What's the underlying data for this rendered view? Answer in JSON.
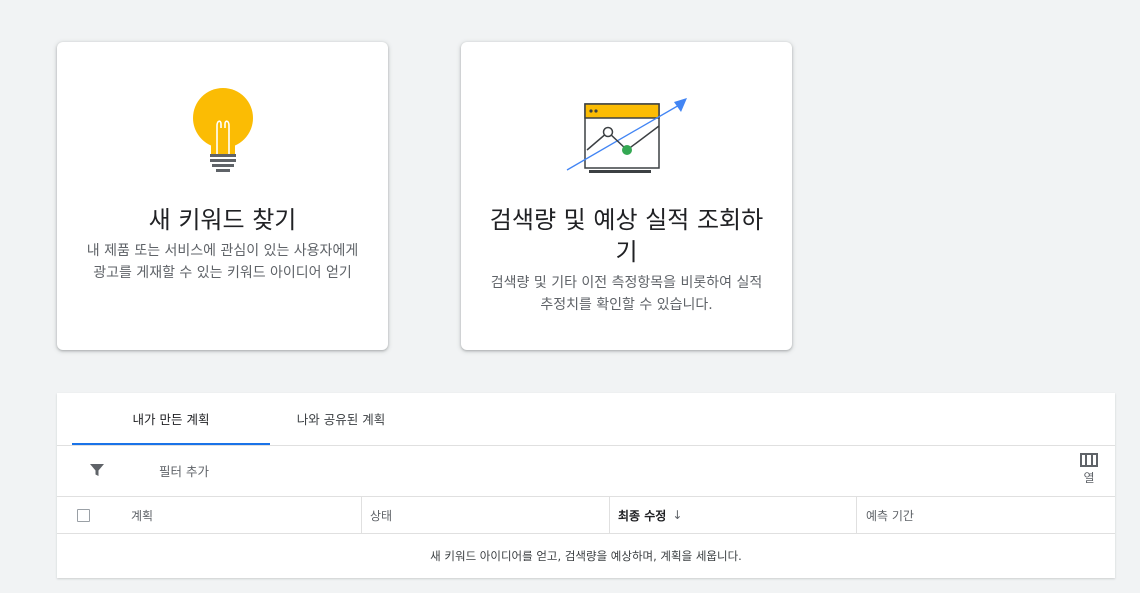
{
  "cards": [
    {
      "title": "새 키워드 찾기",
      "description": "내 제품 또는 서비스에 관심이 있는 사용자에게 광고를 게재할 수 있는 키워드 아이디어 얻기",
      "icon": "lightbulb-icon"
    },
    {
      "title": "검색량 및 예상 실적 조회하기",
      "description": "검색량 및 기타 이전 측정항목을 비롯하여 실적 추정치를 확인할 수 있습니다.",
      "icon": "forecast-chart-icon"
    }
  ],
  "tabs": [
    {
      "label": "내가 만든 계획",
      "active": true
    },
    {
      "label": "나와 공유된 계획",
      "active": false
    }
  ],
  "filter": {
    "label": "필터 추가",
    "icon": "filter-icon"
  },
  "columns_button": {
    "label": "열",
    "icon": "columns-icon"
  },
  "table": {
    "headers": [
      "계획",
      "상태",
      "최종 수정",
      "예측 기간"
    ],
    "sort_icon": "↓",
    "empty_message": "새 키워드 아이디어를 얻고, 검색량을 예상하며, 계획을 세웁니다."
  },
  "colors": {
    "bulb": "#fbbc04",
    "accent_blue": "#4285f4",
    "green": "#34a853"
  }
}
